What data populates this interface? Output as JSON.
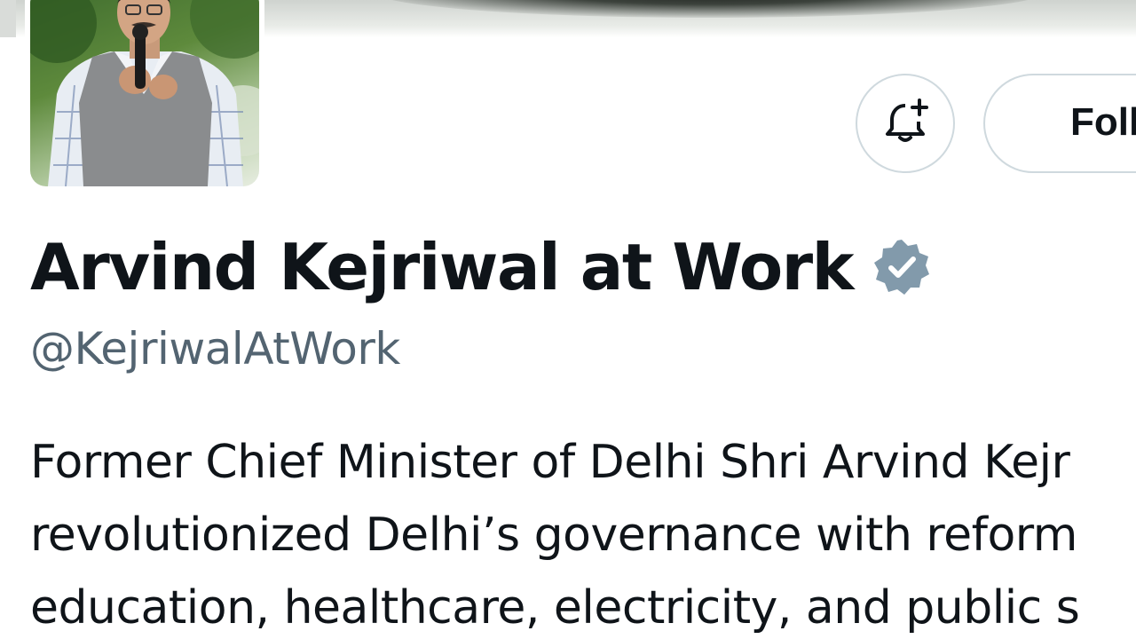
{
  "profile": {
    "display_name": "Arvind Kejriwal at Work",
    "handle": "@KejriwalAtWork",
    "verified": true,
    "verified_color": "#829aab",
    "bio_lines": [
      "Former Chief Minister of Delhi Shri Arvind Kejr",
      "revolutionized Delhi’s governance with reform",
      "education, healthcare, electricity, and public s"
    ]
  },
  "actions": {
    "notify_icon": "bell-plus-icon",
    "follow_label": "Foll"
  },
  "avatar": {
    "icon": "profile-photo"
  },
  "colors": {
    "text_primary": "#0f1419",
    "text_secondary": "#536471",
    "button_border": "#cfd9de"
  }
}
